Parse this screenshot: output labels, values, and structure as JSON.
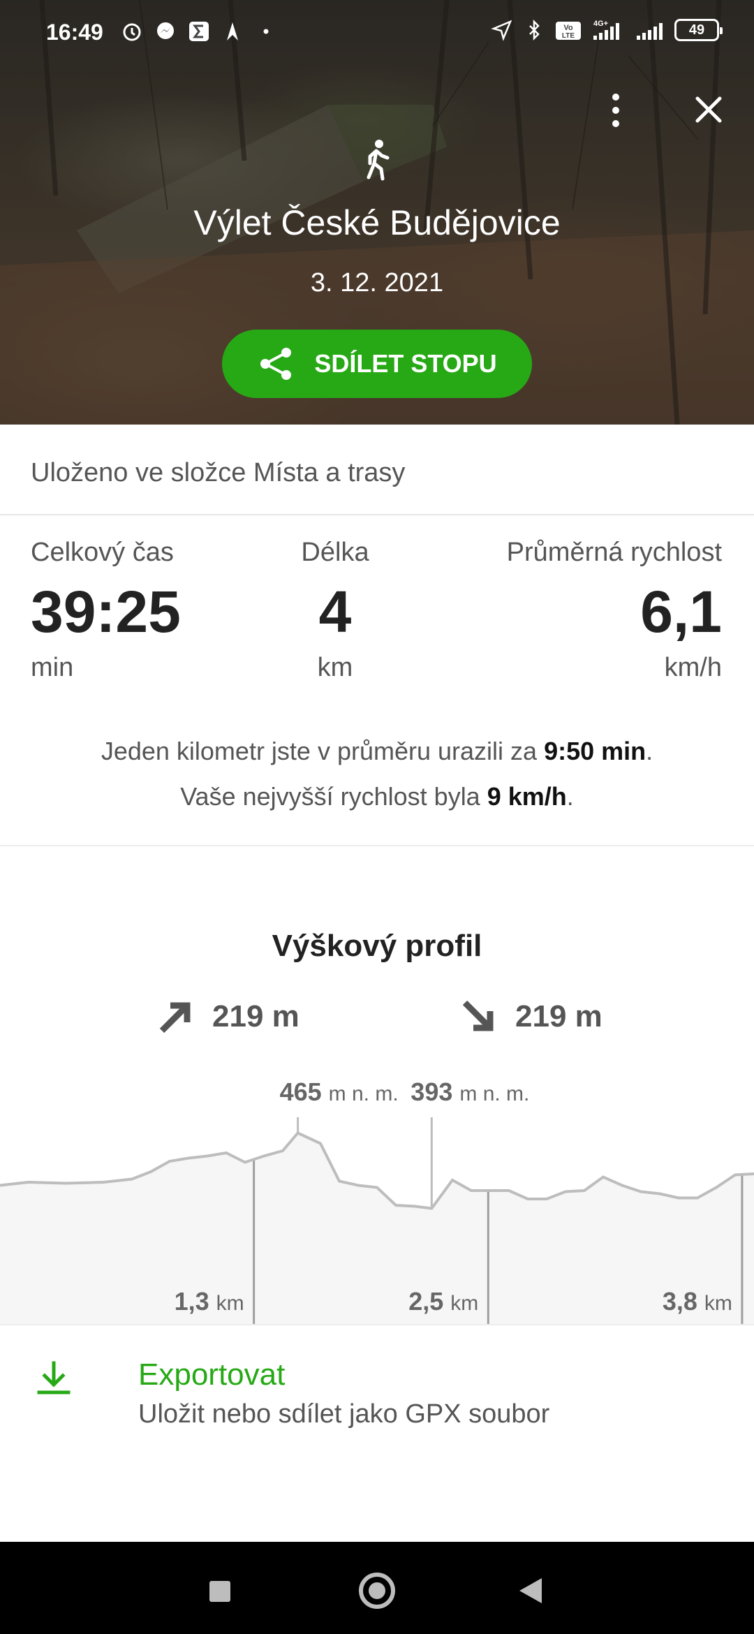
{
  "status_bar": {
    "time": "16:49",
    "battery": "49",
    "network": "4G+",
    "volte": "Vo LTE"
  },
  "hero": {
    "title": "Výlet České Budějovice",
    "date": "3. 12. 2021",
    "share_label": "SDÍLET STOPU",
    "activity_icon": "walking-person-icon"
  },
  "folder": {
    "text": "Uloženo ve složce Místa a trasy"
  },
  "stats": {
    "total_time": {
      "label": "Celkový čas",
      "value": "39:25",
      "unit": "min"
    },
    "length": {
      "label": "Délka",
      "value": "4",
      "unit": "km"
    },
    "avg_speed": {
      "label": "Průměrná rychlost",
      "value": "6,1",
      "unit": "km/h"
    }
  },
  "summary": {
    "line1_prefix": "Jeden kilometr jste v průměru urazili za ",
    "line1_value": "9:50 min",
    "line1_suffix": ".",
    "line2_prefix": "Vaše nejvyšší rychlost byla ",
    "line2_value": "9 km/h",
    "line2_suffix": "."
  },
  "elevation": {
    "title": "Výškový profil",
    "ascent": "219 m",
    "descent": "219 m",
    "max_value": "465",
    "max_unit": "m n. m.",
    "min_value": "393",
    "min_unit": "m n. m.",
    "distance_markers": [
      {
        "value": "1,3",
        "unit": "km"
      },
      {
        "value": "2,5",
        "unit": "km"
      },
      {
        "value": "3,8",
        "unit": "km"
      }
    ]
  },
  "chart_data": {
    "type": "area",
    "title": "Výškový profil",
    "xlabel": "",
    "ylabel": "",
    "x_unit": "km",
    "y_unit": "m n. m.",
    "xlim": [
      0,
      4
    ],
    "ylim": [
      380,
      480
    ],
    "x_ticks": [
      "1,3",
      "2,5",
      "3,8"
    ],
    "annotations": [
      {
        "label": "465",
        "x": 1.58,
        "y": 465
      },
      {
        "label": "393",
        "x": 2.29,
        "y": 393
      }
    ],
    "series": [
      {
        "x": [
          0,
          0.15,
          0.35,
          0.55,
          0.7,
          0.8,
          0.9,
          1.0,
          1.1,
          1.2,
          1.3,
          1.4,
          1.5,
          1.58,
          1.7,
          1.8,
          1.9,
          2.0,
          2.1,
          2.2,
          2.29,
          2.4,
          2.5,
          2.6,
          2.7,
          2.8,
          2.9,
          3.0,
          3.1,
          3.2,
          3.3,
          3.4,
          3.5,
          3.6,
          3.7,
          3.8,
          3.9,
          4.0
        ],
        "y": [
          415,
          418,
          417,
          418,
          421,
          428,
          438,
          441,
          443,
          446,
          437,
          443,
          448,
          465,
          455,
          419,
          415,
          413,
          396,
          395,
          393,
          420,
          410,
          410,
          410,
          402,
          402,
          409,
          410,
          423,
          415,
          409,
          407,
          403,
          403,
          413,
          425,
          426
        ]
      }
    ]
  },
  "export": {
    "title": "Exportovat",
    "subtitle": "Uložit nebo sdílet jako GPX soubor"
  }
}
